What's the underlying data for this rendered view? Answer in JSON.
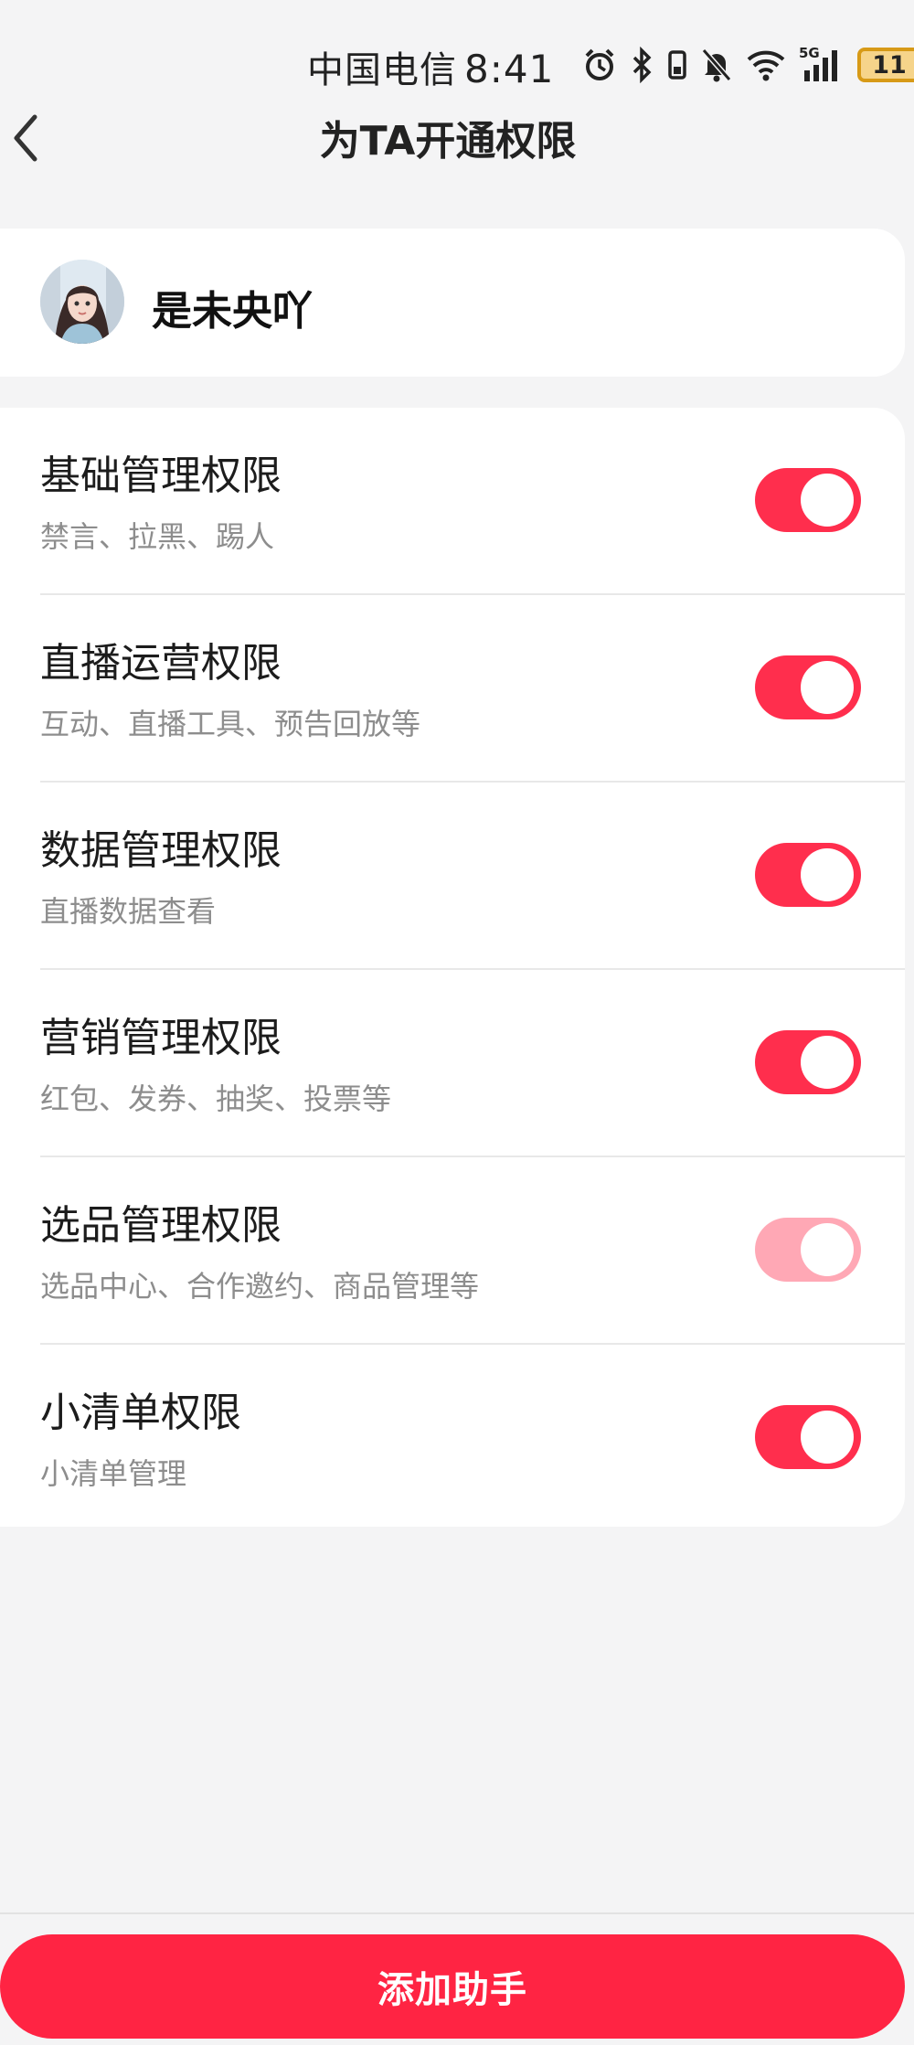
{
  "status_bar": {
    "carrier": "中国电信",
    "time": "8:41",
    "network": "5G",
    "battery": "11",
    "icons": [
      "alarm-icon",
      "bluetooth-icon",
      "vibrate-icon",
      "mute-bell-icon",
      "wifi-icon",
      "signal-icon",
      "battery-icon"
    ]
  },
  "header": {
    "title": "为TA开通权限",
    "back_icon": "chevron-left-icon"
  },
  "user": {
    "name": "是未央吖"
  },
  "permissions": [
    {
      "title": "基础管理权限",
      "desc": "禁言、拉黑、踢人",
      "enabled": true,
      "disabled": false
    },
    {
      "title": "直播运营权限",
      "desc": "互动、直播工具、预告回放等",
      "enabled": true,
      "disabled": false
    },
    {
      "title": "数据管理权限",
      "desc": "直播数据查看",
      "enabled": true,
      "disabled": false
    },
    {
      "title": "营销管理权限",
      "desc": "红包、发券、抽奖、投票等",
      "enabled": true,
      "disabled": false
    },
    {
      "title": "选品管理权限",
      "desc": "选品中心、合作邀约、商品管理等",
      "enabled": true,
      "disabled": true
    },
    {
      "title": "小清单权限",
      "desc": "小清单管理",
      "enabled": true,
      "disabled": false
    }
  ],
  "footer": {
    "button_label": "添加助手"
  },
  "colors": {
    "accent": "#ff2443",
    "toggle_on": "#ff2e4d",
    "toggle_disabled": "#ffa8b5",
    "background": "#f4f4f5"
  }
}
